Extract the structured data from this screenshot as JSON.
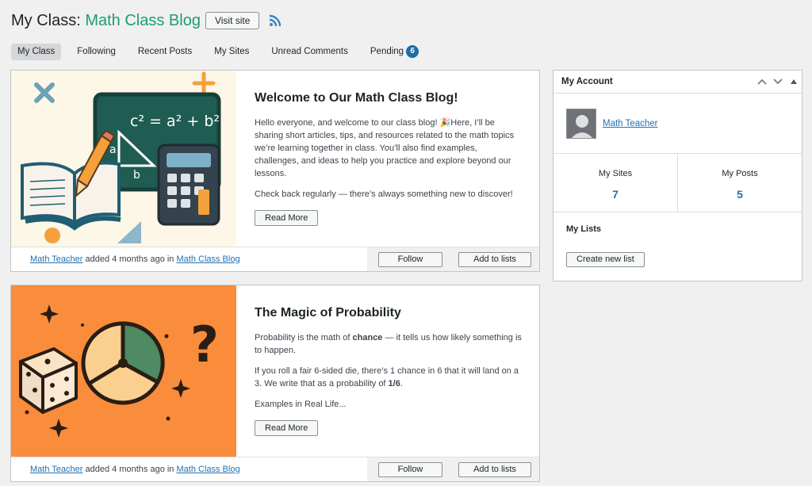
{
  "header": {
    "title_prefix": "My Class: ",
    "blog_name": "Math Class Blog",
    "visit_label": "Visit site"
  },
  "tabs": [
    {
      "label": "My Class",
      "active": true
    },
    {
      "label": "Following"
    },
    {
      "label": "Recent Posts"
    },
    {
      "label": "My Sites"
    },
    {
      "label": "Unread Comments"
    },
    {
      "label": "Pending",
      "badge": "6"
    }
  ],
  "posts": [
    {
      "title": "Welcome to Our Math Class Blog!",
      "paragraphs": [
        "Hello everyone, and welcome to our class blog! 🎉Here, I’ll be sharing short articles, tips, and resources related to the math topics we’re learning together in class. You’ll also find examples, challenges, and ideas to help you practice and explore beyond our lessons.",
        "Check back regularly — there’s always something new to discover!"
      ],
      "read_more": "Read More",
      "author": "Math Teacher",
      "meta_mid": " added 4 months ago in ",
      "blog": "Math Class Blog",
      "follow_label": "Follow",
      "lists_label": "Add to lists",
      "image_text": {
        "eq": "c² = a² + b²",
        "a": "a",
        "b": "b"
      }
    },
    {
      "title": "The Magic of Probability",
      "p1_pre": "Probability is the math of ",
      "p1_bold": "chance",
      "p1_post": " — it tells us how likely something is to happen.",
      "p2_pre": "If you roll a fair 6-sided die, there’s 1 chance in 6 that it will land on a 3. We write that as a probability of ",
      "p2_bold": "1/6",
      "p2_post": ".",
      "p3": "Examples in Real Life...",
      "read_more": "Read More",
      "author": "Math Teacher",
      "meta_mid": " added 4 months ago in ",
      "blog": "Math Class Blog",
      "follow_label": "Follow",
      "lists_label": "Add to lists",
      "image_text": {
        "q": "?"
      }
    }
  ],
  "widget": {
    "title": "My Account",
    "user_name": "Math Teacher",
    "stats": [
      {
        "label": "My Sites",
        "value": "7"
      },
      {
        "label": "My Posts",
        "value": "5"
      }
    ],
    "lists_title": "My Lists",
    "create_label": "Create new list"
  },
  "colors": {
    "accent_green": "#1d9e6e",
    "link_blue": "#2271b1",
    "badge_blue": "#1d6fa5",
    "rss_blue": "#3582c4"
  }
}
